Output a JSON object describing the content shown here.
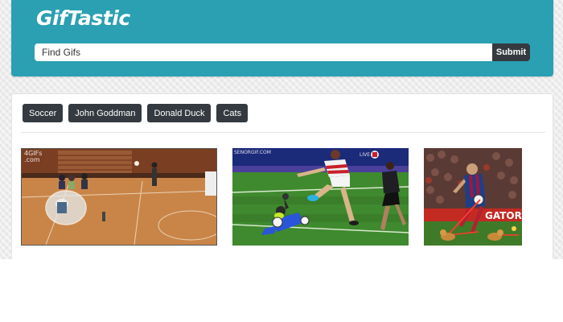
{
  "app": {
    "title": "GifTastic"
  },
  "search": {
    "placeholder": "Find Gifs",
    "value": "",
    "submit_label": "Submit"
  },
  "topics": [
    {
      "label": "Soccer"
    },
    {
      "label": "John Goddman"
    },
    {
      "label": "Donald Duck"
    },
    {
      "label": "Cats"
    }
  ],
  "gifs": [
    {
      "watermark_line1": "4GIFs",
      "watermark_line2": ".com"
    },
    {
      "watermark_line1": "SENORGIF.COM",
      "watermark_line2": "LIVE"
    },
    {
      "watermark_line1": "GATOR"
    }
  ],
  "colors": {
    "header_bg": "#2aa0b2",
    "button_dark": "#343a40",
    "text_white": "#ffffff"
  }
}
